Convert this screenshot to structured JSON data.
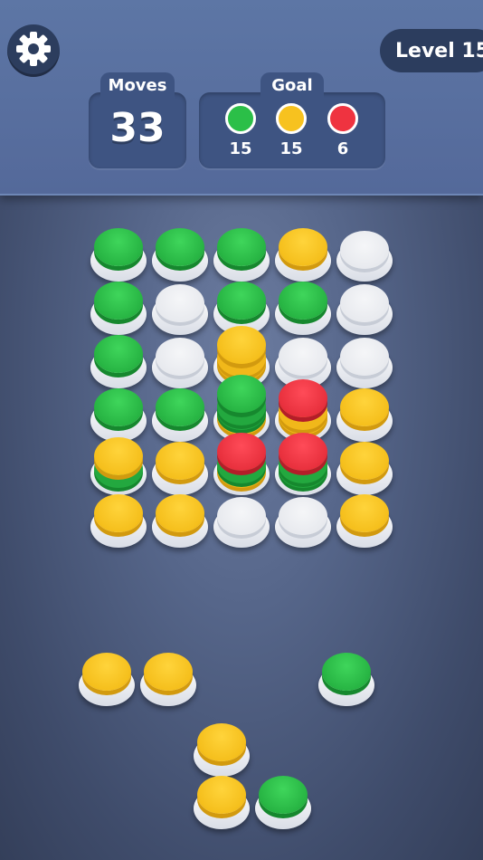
{
  "header": {
    "level_label": "Level 15",
    "moves_label": "Moves",
    "moves_value": "33",
    "goal_label": "Goal",
    "goals": [
      {
        "color": "green",
        "count": "15"
      },
      {
        "color": "yellow",
        "count": "15"
      },
      {
        "color": "red",
        "count": "6"
      }
    ]
  },
  "colors": {
    "green": "#2bbf48",
    "yellow": "#f7c21f",
    "red": "#ef3340",
    "empty": "#e9ebef",
    "panel": "#3e5482",
    "settings_icon": "gear-icon"
  },
  "board": {
    "rows": [
      [
        {
          "color": "green"
        },
        {
          "color": "green"
        },
        {
          "color": "green"
        },
        {
          "color": "yellow"
        },
        {
          "color": "empty"
        }
      ],
      [
        {
          "color": "green"
        },
        {
          "color": "empty"
        },
        {
          "color": "green"
        },
        {
          "color": "green"
        },
        {
          "color": "empty"
        }
      ],
      [
        {
          "color": "green"
        },
        {
          "color": "empty"
        },
        {
          "color": "yellow",
          "stack": [
            "yellow",
            "yellow"
          ]
        },
        {
          "color": "empty"
        },
        {
          "color": "empty"
        }
      ],
      [
        {
          "color": "green"
        },
        {
          "color": "green"
        },
        {
          "color": "green",
          "stack": [
            "yellow",
            "green",
            "green"
          ]
        },
        {
          "color": "red",
          "stack": [
            "yellow",
            "yellow"
          ]
        },
        {
          "color": "yellow"
        }
      ],
      [
        {
          "color": "yellow",
          "stack": [
            "green"
          ]
        },
        {
          "color": "yellow"
        },
        {
          "color": "red",
          "stack": [
            "yellow",
            "green"
          ]
        },
        {
          "color": "red",
          "stack": [
            "green",
            "green"
          ]
        },
        {
          "color": "yellow"
        }
      ],
      [
        {
          "color": "yellow"
        },
        {
          "color": "yellow"
        },
        {
          "color": "empty"
        },
        {
          "color": "empty"
        },
        {
          "color": "yellow"
        }
      ]
    ]
  },
  "tray": {
    "pieces": [
      {
        "color": "yellow"
      },
      {
        "color": "yellow"
      },
      {
        "color": "green"
      },
      {
        "color": "yellow"
      },
      {
        "color": "yellow"
      },
      {
        "color": "green"
      }
    ]
  }
}
